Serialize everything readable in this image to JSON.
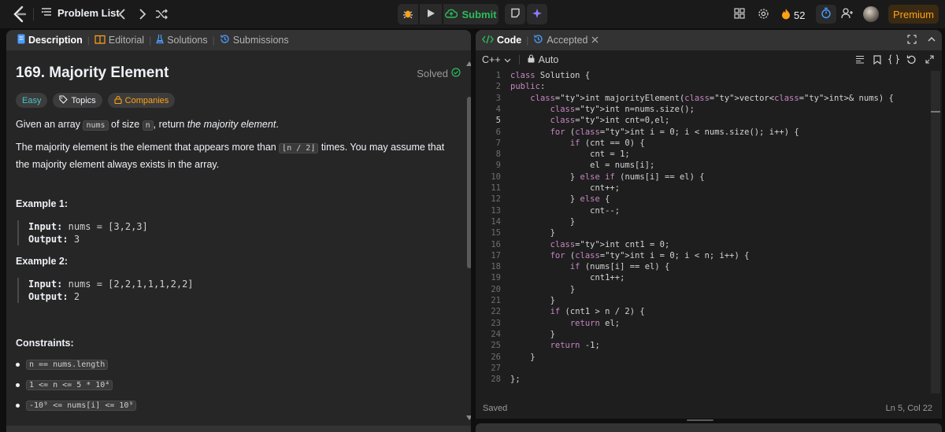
{
  "topbar": {
    "problem_list_label": "Problem List",
    "submit_label": "Submit",
    "streak_count": "52",
    "premium_label": "Premium"
  },
  "left": {
    "tabs": [
      {
        "label": "Description"
      },
      {
        "label": "Editorial"
      },
      {
        "label": "Solutions"
      },
      {
        "label": "Submissions"
      }
    ],
    "title": "169. Majority Element",
    "solved_label": "Solved",
    "chips": {
      "difficulty": "Easy",
      "topics": "Topics",
      "companies": "Companies"
    },
    "desc1": {
      "a": "Given an array ",
      "c1": "nums",
      "b": " of size ",
      "c2": "n",
      "d": ", return ",
      "em": "the majority element",
      "e": "."
    },
    "desc2": {
      "a": "The majority element is the element that appears more than ",
      "c": "⌊n / 2⌋",
      "b": " times. You may assume that the majority element always exists in the array."
    },
    "example1": {
      "heading": "Example 1:",
      "input_label": "Input:",
      "input": "nums = [3,2,3]",
      "output_label": "Output:",
      "output": "3"
    },
    "example2": {
      "heading": "Example 2:",
      "input_label": "Input:",
      "input": "nums = [2,2,1,1,1,2,2]",
      "output_label": "Output:",
      "output": "2"
    },
    "constraints": {
      "heading": "Constraints:",
      "items": [
        "n == nums.length",
        "1 <= n <= 5 * 10⁴",
        "-10⁹ <= nums[i] <= 10⁹"
      ]
    }
  },
  "right": {
    "code_tab": "Code",
    "accepted_tab": "Accepted",
    "language": "C++",
    "mode": "Auto",
    "saved_label": "Saved",
    "cursor_pos": "Ln 5, Col 22",
    "lines": [
      "class Solution {",
      "public:",
      "    int majorityElement(vector<int>& nums) {",
      "        int n=nums.size();",
      "        int cnt=0,el;",
      "        for (int i = 0; i < nums.size(); i++) {",
      "            if (cnt == 0) {",
      "                cnt = 1;",
      "                el = nums[i];",
      "            } else if (nums[i] == el) {",
      "                cnt++;",
      "            } else {",
      "                cnt--;",
      "            }",
      "        }",
      "        int cnt1 = 0;",
      "        for (int i = 0; i < n; i++) {",
      "            if (nums[i] == el) {",
      "                cnt1++;",
      "            }",
      "        }",
      "        if (cnt1 > n / 2) {",
      "            return el;",
      "        }",
      "        return -1;",
      "    }",
      "",
      "};"
    ],
    "current_line": 5
  },
  "colors": {
    "accent": "#ffa116",
    "submit": "#2cbb5d",
    "easy": "#46c6c2"
  }
}
